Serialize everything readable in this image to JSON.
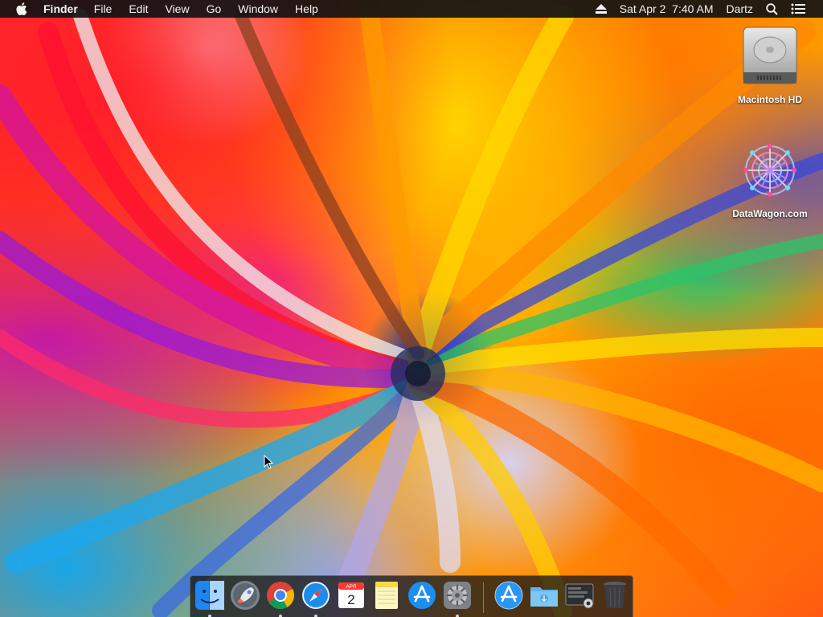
{
  "menubar": {
    "apple_icon": "apple-icon",
    "app_name": "Finder",
    "menus": [
      "File",
      "Edit",
      "View",
      "Go",
      "Window",
      "Help"
    ],
    "status": {
      "eject_icon": "eject-icon",
      "datetime": "Sat Apr 2  7:40 AM",
      "user": "Dartz",
      "search_icon": "spotlight-search-icon",
      "notification_icon": "notification-center-icon"
    }
  },
  "desktop": {
    "icons": [
      {
        "label": "Macintosh HD",
        "icon": "hard-drive-icon"
      },
      {
        "label": "DataWagon.com",
        "icon": "network-volume-icon"
      }
    ]
  },
  "dock": {
    "apps": [
      {
        "name": "Finder",
        "icon": "finder-icon",
        "running": true
      },
      {
        "name": "Launchpad",
        "icon": "launchpad-rocket-icon",
        "running": false
      },
      {
        "name": "Google Chrome",
        "icon": "chrome-icon",
        "running": true
      },
      {
        "name": "Safari",
        "icon": "safari-compass-icon",
        "running": true
      },
      {
        "name": "Calendar",
        "icon": "calendar-icon",
        "running": false,
        "month": "APR",
        "day": "2"
      },
      {
        "name": "Notes",
        "icon": "notes-icon",
        "running": false
      },
      {
        "name": "App Store",
        "icon": "app-store-icon",
        "running": false
      },
      {
        "name": "System Preferences",
        "icon": "gear-icon",
        "running": true
      },
      {
        "name": "Applications",
        "icon": "app-store-icon",
        "running": false
      },
      {
        "name": "Downloads",
        "icon": "folder-icon",
        "running": false
      },
      {
        "name": "Screenshot",
        "icon": "screenshot-icon",
        "running": false
      },
      {
        "name": "Trash",
        "icon": "trash-icon",
        "running": false
      }
    ]
  },
  "colors": {
    "menubar_bg": "#121212",
    "menubar_text": "#f4f4f4",
    "dock_bg": "#191919"
  }
}
